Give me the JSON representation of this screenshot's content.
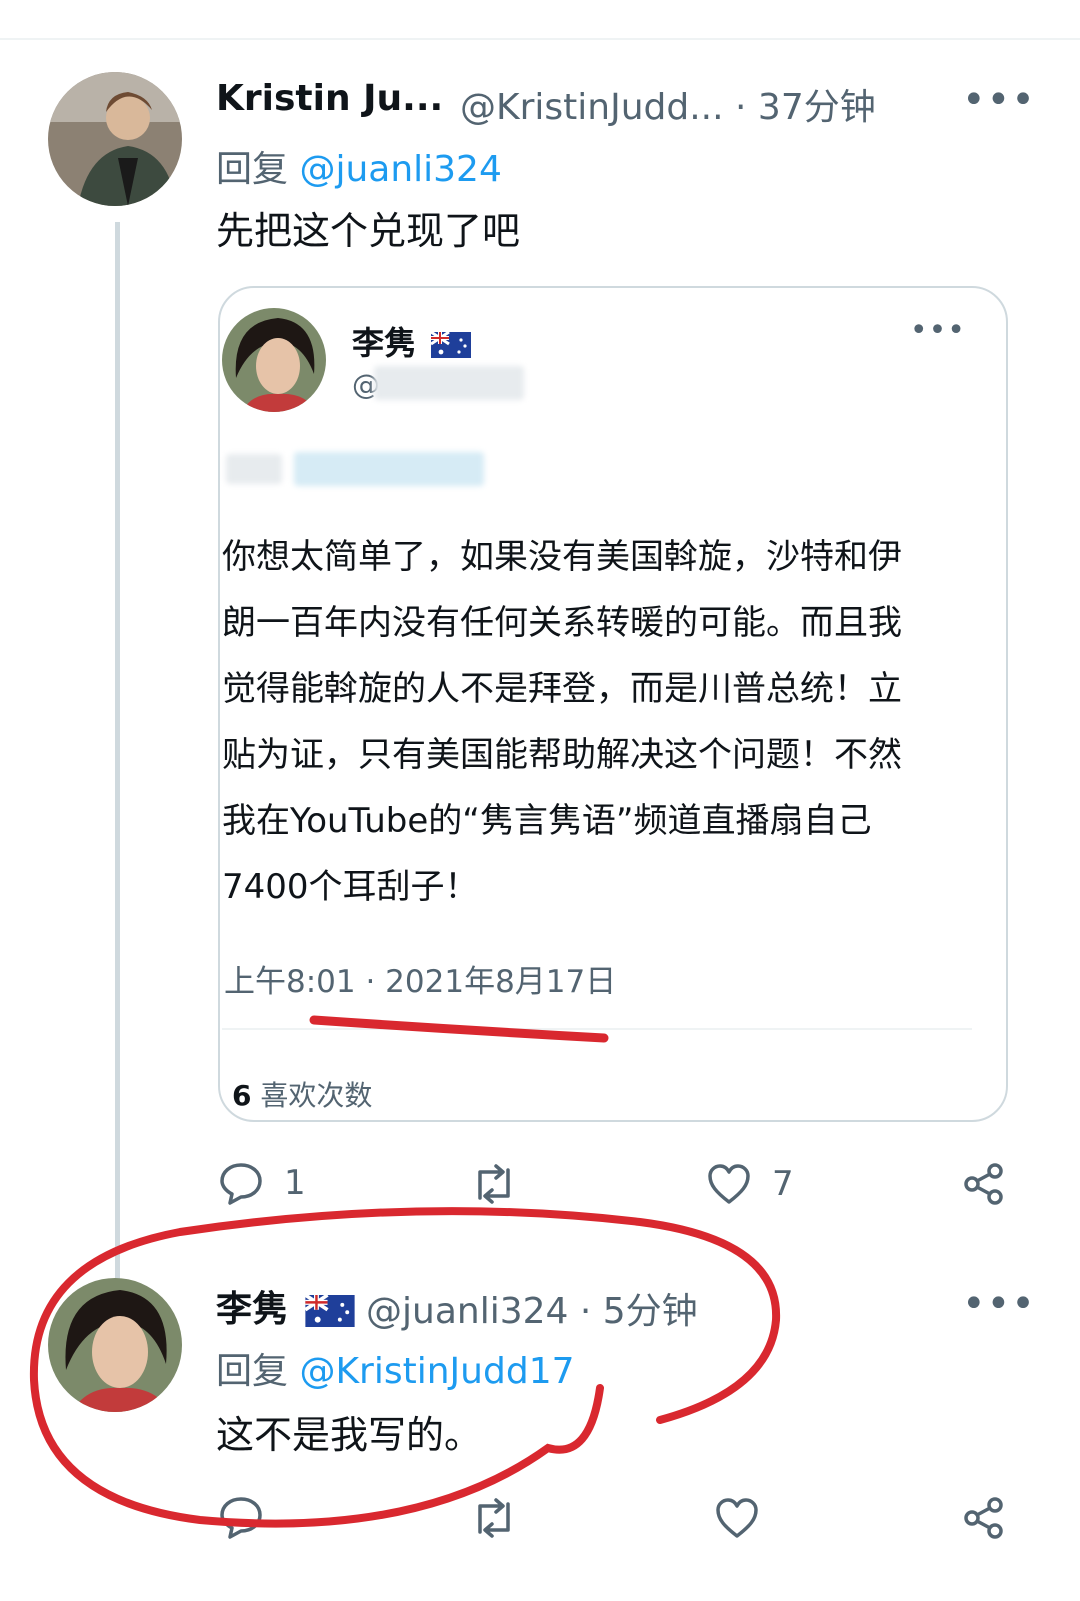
{
  "tweet1": {
    "author_name": "Kristin Ju...",
    "author_handle": "@KristinJudd...",
    "time": " · 37分钟",
    "reply_prefix": "回复 ",
    "reply_to": "@juanli324",
    "text": "先把这个兑现了吧",
    "avatar_icon": "user-photo-icon",
    "actions": {
      "reply_count": "1",
      "retweet_count": "",
      "like_count": "7"
    }
  },
  "quoted": {
    "author_name": "李隽",
    "author_handle": "@",
    "flag_icon": "australia-flag-icon",
    "text": "你想太简单了，如果没有美国斡旋，沙特和伊\n朗一百年内没有任何关系转暖的可能。而且我\n觉得能斡旋的人不是拜登，而是川普总统！立\n贴为证，只有美国能帮助解决这个问题！不然\n我在YouTube的“隽言隽语”频道直播扇自己\n7400个耳刮子！",
    "timestamp": "上午8:01 · 2021年8月17日",
    "likes_count": "6",
    "likes_label": " 喜欢次数"
  },
  "tweet2": {
    "author_name": "李隽",
    "author_handle": "@juanli324",
    "time": " · 5分钟",
    "reply_prefix": "回复 ",
    "reply_to": "@KristinJudd17",
    "text": "这不是我写的。"
  },
  "colors": {
    "accent": "#1d9bf0",
    "secondary_text": "#536471",
    "annotation_red": "#d9282f"
  }
}
